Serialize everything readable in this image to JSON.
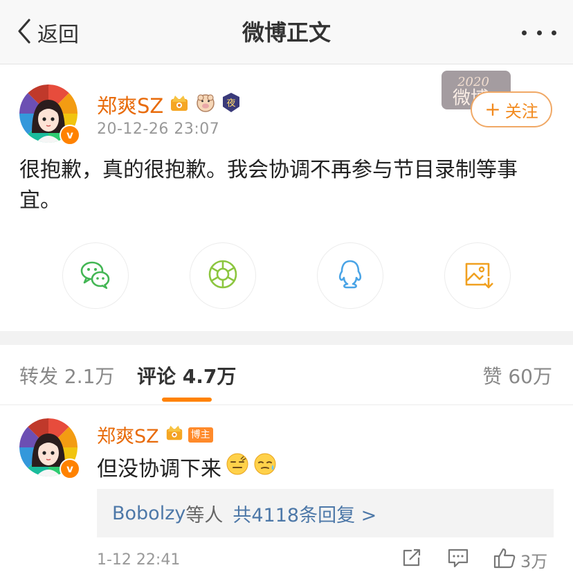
{
  "nav": {
    "back_label": "返回",
    "title": "微博正文"
  },
  "post": {
    "author": "郑爽SZ",
    "time": "20-12-26 23:07",
    "follow_label": "关注",
    "text": "很抱歉，真的很抱歉。我会协调不再参与节目录制等事宜。",
    "banner_year": "2020",
    "banner_text": "微博"
  },
  "badges": {
    "night": "夜",
    "v": "v"
  },
  "tabs": {
    "repost": "转发 2.1万",
    "comments": "评论 4.7万",
    "likes": "赞 60万"
  },
  "comment": {
    "author": "郑爽SZ",
    "host_tag": "博主",
    "text": "但没协调下来",
    "replies_who": "Bobolzy",
    "replies_tail": "等人",
    "replies_count": "共4118条回复 >",
    "time": "1-12 22:41",
    "likes": "3万"
  },
  "icons": {
    "back": "chevron-left-icon",
    "more": "more-dots-icon",
    "share": [
      "wechat-icon",
      "moments-icon",
      "qq-icon",
      "save-image-icon"
    ],
    "actions": [
      "repost-icon",
      "comment-icon",
      "like-icon"
    ]
  },
  "colors": {
    "accent": "#ff8200",
    "author": "#e86b0a",
    "link": "#4d78a8",
    "wechat": "#43b654",
    "moments": "#8cc63f",
    "qq": "#4aa4e6",
    "save": "#f0a020"
  }
}
